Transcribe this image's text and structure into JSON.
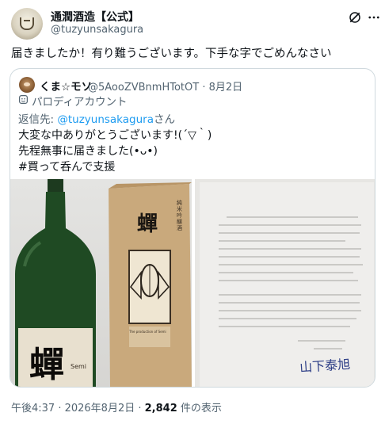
{
  "author": {
    "name": "通潤酒造【公式】",
    "handle": "@tuzyunsakagura"
  },
  "tweet": {
    "text": "届きましたか！有り難うございます。下手な字でごめんなさい"
  },
  "quoted": {
    "name": "くま☆モソ",
    "handle": "@5AooZVBnmHTotOT · 8月2日",
    "parody_label": "パロディアカウント",
    "reply_prefix": "返信先: ",
    "reply_mention": "@tuzyunsakagura",
    "reply_suffix": "さん",
    "lines": [
      "大変な中ありがとうございます!(´▽｀)",
      "先程無事に届きました(•ᴗ•)",
      " #買って呑んで支援"
    ]
  },
  "photos": {
    "bottle_label": "蟬",
    "bottle_sublabel": "Semi",
    "box_label": "蟬",
    "box_vertical": "純米吟醸酒",
    "box_caption": "The production of Semi",
    "letter_signature": "山下泰旭"
  },
  "meta": {
    "time": "午後4:37 · 2026年8月2日 · ",
    "views": "2,842",
    "views_suffix": " 件の表示"
  },
  "colors": {
    "link": "#1d9bf0",
    "secondary": "#536471",
    "border": "#cfd9de"
  }
}
